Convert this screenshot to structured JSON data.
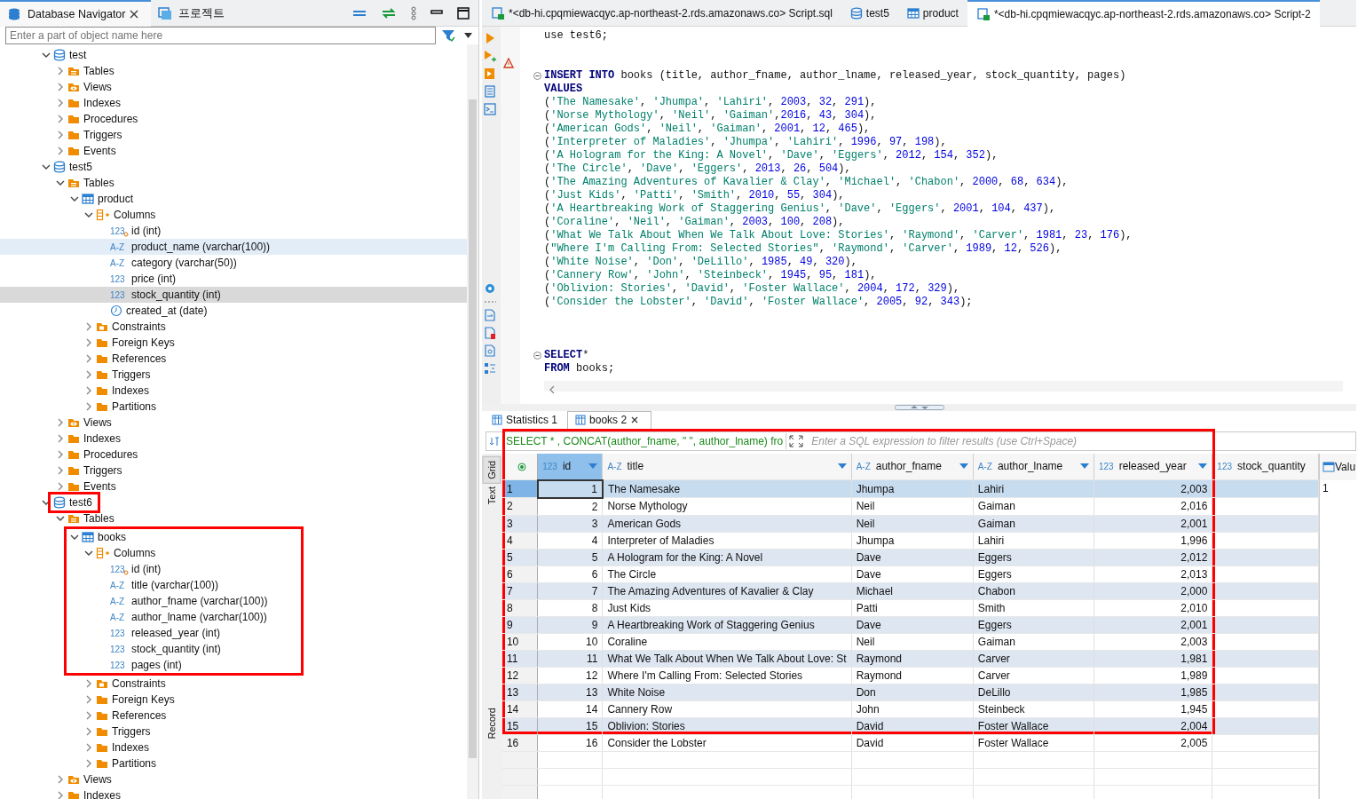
{
  "navigator": {
    "tabs": [
      {
        "label": "Database Navigator",
        "selected": true,
        "closable": true
      },
      {
        "label": "프로젝트",
        "selected": false,
        "closable": false
      }
    ],
    "search": {
      "placeholder": "Enter a part of object name here"
    },
    "tree": [
      {
        "label": "test",
        "kind": "database",
        "expanded": true,
        "selected": false,
        "children": [
          {
            "label": "Tables",
            "kind": "tables",
            "expanded": false,
            "selected": false
          },
          {
            "label": "Views",
            "kind": "views",
            "expanded": false,
            "selected": false
          },
          {
            "label": "Indexes",
            "kind": "folder",
            "expanded": false,
            "selected": false
          },
          {
            "label": "Procedures",
            "kind": "folder",
            "expanded": false,
            "selected": false
          },
          {
            "label": "Triggers",
            "kind": "folder",
            "expanded": false,
            "selected": false
          },
          {
            "label": "Events",
            "kind": "folder",
            "expanded": false,
            "selected": false
          }
        ]
      },
      {
        "label": "test5",
        "kind": "database",
        "expanded": true,
        "selected": false,
        "children": [
          {
            "label": "Tables",
            "kind": "tables",
            "expanded": true,
            "selected": false,
            "children": [
              {
                "label": "product",
                "kind": "table",
                "expanded": true,
                "selected": false,
                "children": [
                  {
                    "label": "Columns",
                    "kind": "columns",
                    "expanded": true,
                    "selected": false,
                    "children": [
                      {
                        "label": "id (int)",
                        "kind": "column",
                        "type": "123",
                        "key": true,
                        "selected": false
                      },
                      {
                        "label": "product_name (varchar(100))",
                        "kind": "column",
                        "type": "A-Z",
                        "hovered": true,
                        "selected": false
                      },
                      {
                        "label": "category (varchar(50))",
                        "kind": "column",
                        "type": "A-Z",
                        "selected": false
                      },
                      {
                        "label": "price (int)",
                        "kind": "column",
                        "type": "123",
                        "selected": false
                      },
                      {
                        "label": "stock_quantity (int)",
                        "kind": "column",
                        "type": "123",
                        "selected": true
                      },
                      {
                        "label": "created_at (date)",
                        "kind": "date_column",
                        "selected": false
                      }
                    ]
                  },
                  {
                    "label": "Constraints",
                    "kind": "constraints",
                    "expanded": false,
                    "selected": false
                  },
                  {
                    "label": "Foreign Keys",
                    "kind": "folder",
                    "expanded": false,
                    "selected": false
                  },
                  {
                    "label": "References",
                    "kind": "folder",
                    "expanded": false,
                    "selected": false
                  },
                  {
                    "label": "Triggers",
                    "kind": "folder",
                    "expanded": false,
                    "selected": false
                  },
                  {
                    "label": "Indexes",
                    "kind": "folder",
                    "expanded": false,
                    "selected": false
                  },
                  {
                    "label": "Partitions",
                    "kind": "folder",
                    "expanded": false,
                    "selected": false
                  }
                ]
              }
            ]
          },
          {
            "label": "Views",
            "kind": "views",
            "expanded": false,
            "selected": false
          },
          {
            "label": "Indexes",
            "kind": "folder",
            "expanded": false,
            "selected": false
          },
          {
            "label": "Procedures",
            "kind": "folder",
            "expanded": false,
            "selected": false
          },
          {
            "label": "Triggers",
            "kind": "folder",
            "expanded": false,
            "selected": false
          },
          {
            "label": "Events",
            "kind": "folder",
            "expanded": false,
            "selected": false
          }
        ]
      },
      {
        "label": "test6",
        "kind": "database",
        "expanded": true,
        "selected": false,
        "highlighted": true,
        "children": [
          {
            "label": "Tables",
            "kind": "tables",
            "expanded": true,
            "selected": false,
            "children": [
              {
                "label": "books",
                "kind": "table",
                "expanded": true,
                "selected": false,
                "highlighted": true,
                "children": [
                  {
                    "label": "Columns",
                    "kind": "columns",
                    "expanded": true,
                    "selected": false,
                    "children": [
                      {
                        "label": "id (int)",
                        "kind": "column",
                        "type": "123",
                        "key": true,
                        "selected": false
                      },
                      {
                        "label": "title (varchar(100))",
                        "kind": "column",
                        "type": "A-Z",
                        "selected": false
                      },
                      {
                        "label": "author_fname (varchar(100))",
                        "kind": "column",
                        "type": "A-Z",
                        "selected": false
                      },
                      {
                        "label": "author_lname (varchar(100))",
                        "kind": "column",
                        "type": "A-Z",
                        "selected": false
                      },
                      {
                        "label": "released_year (int)",
                        "kind": "column",
                        "type": "123",
                        "selected": false
                      },
                      {
                        "label": "stock_quantity (int)",
                        "kind": "column",
                        "type": "123",
                        "selected": false
                      },
                      {
                        "label": "pages (int)",
                        "kind": "column",
                        "type": "123",
                        "selected": false
                      }
                    ]
                  },
                  {
                    "label": "Constraints",
                    "kind": "constraints",
                    "expanded": false,
                    "selected": false
                  },
                  {
                    "label": "Foreign Keys",
                    "kind": "folder",
                    "expanded": false,
                    "selected": false
                  },
                  {
                    "label": "References",
                    "kind": "folder",
                    "expanded": false,
                    "selected": false
                  },
                  {
                    "label": "Triggers",
                    "kind": "folder",
                    "expanded": false,
                    "selected": false
                  },
                  {
                    "label": "Indexes",
                    "kind": "folder",
                    "expanded": false,
                    "selected": false
                  },
                  {
                    "label": "Partitions",
                    "kind": "folder",
                    "expanded": false,
                    "selected": false
                  }
                ]
              }
            ]
          },
          {
            "label": "Views",
            "kind": "views",
            "expanded": false,
            "selected": false
          },
          {
            "label": "Indexes",
            "kind": "folder",
            "expanded": false,
            "selected": false
          }
        ]
      }
    ]
  },
  "editor": {
    "tabs": [
      {
        "label": "*<db-hi.cpqmiewacqyc.ap-northeast-2.rds.amazonaws.co> Script.sql",
        "kind": "script",
        "selected": false
      },
      {
        "label": "test5",
        "kind": "database",
        "selected": false
      },
      {
        "label": "product",
        "kind": "table",
        "selected": false
      },
      {
        "label": "*<db-hi.cpqmiewacqyc.ap-northeast-2.rds.amazonaws.co> Script-2",
        "kind": "script",
        "selected": true
      }
    ],
    "lines": [
      {
        "kind": "code",
        "text": "use test6;"
      },
      {
        "kind": "blank"
      },
      {
        "kind": "blank",
        "warning": true
      },
      {
        "kind": "code",
        "text": "INSERT INTO books (title, author_fname, author_lname, released_year, stock_quantity, pages)",
        "fold": true
      },
      {
        "kind": "code",
        "text": "VALUES"
      },
      {
        "kind": "code",
        "text": "('The Namesake', 'Jhumpa', 'Lahiri', 2003, 32, 291),"
      },
      {
        "kind": "code",
        "text": "('Norse Mythology', 'Neil', 'Gaiman',2016, 43, 304),"
      },
      {
        "kind": "code",
        "text": "('American Gods', 'Neil', 'Gaiman', 2001, 12, 465),"
      },
      {
        "kind": "code",
        "text": "('Interpreter of Maladies', 'Jhumpa', 'Lahiri', 1996, 97, 198),"
      },
      {
        "kind": "code",
        "text": "('A Hologram for the King: A Novel', 'Dave', 'Eggers', 2012, 154, 352),"
      },
      {
        "kind": "code",
        "text": "('The Circle', 'Dave', 'Eggers', 2013, 26, 504),"
      },
      {
        "kind": "code",
        "text": "('The Amazing Adventures of Kavalier & Clay', 'Michael', 'Chabon', 2000, 68, 634),"
      },
      {
        "kind": "code",
        "text": "('Just Kids', 'Patti', 'Smith', 2010, 55, 304),"
      },
      {
        "kind": "code",
        "text": "('A Heartbreaking Work of Staggering Genius', 'Dave', 'Eggers', 2001, 104, 437),"
      },
      {
        "kind": "code",
        "text": "('Coraline', 'Neil', 'Gaiman', 2003, 100, 208),"
      },
      {
        "kind": "code",
        "text": "('What We Talk About When We Talk About Love: Stories', 'Raymond', 'Carver', 1981, 23, 176),"
      },
      {
        "kind": "code",
        "text": "(\"Where I'm Calling From: Selected Stories\", 'Raymond', 'Carver', 1989, 12, 526),"
      },
      {
        "kind": "code",
        "text": "('White Noise', 'Don', 'DeLillo', 1985, 49, 320),"
      },
      {
        "kind": "code",
        "text": "('Cannery Row', 'John', 'Steinbeck', 1945, 95, 181),"
      },
      {
        "kind": "code",
        "text": "('Oblivion: Stories', 'David', 'Foster Wallace', 2004, 172, 329),"
      },
      {
        "kind": "code",
        "text": "('Consider the Lobster', 'David', 'Foster Wallace', 2005, 92, 343);"
      },
      {
        "kind": "blank"
      },
      {
        "kind": "blank"
      },
      {
        "kind": "blank"
      },
      {
        "kind": "code",
        "text": "SELECT*",
        "fold": true
      },
      {
        "kind": "code",
        "text": "FROM books;"
      }
    ]
  },
  "results": {
    "tabs": [
      {
        "label": "Statistics 1",
        "selected": false,
        "closable": false
      },
      {
        "label": "books 2",
        "selected": true,
        "closable": true
      }
    ],
    "query": "SELECT * , CONCAT(author_fname, \" \", author_lname) fro",
    "filter": {
      "placeholder": "Enter a SQL expression to filter results (use Ctrl+Space)"
    },
    "side_tabs": [
      {
        "label": "Grid",
        "selected": true
      },
      {
        "label": "Text",
        "selected": false
      },
      {
        "label": "Record",
        "selected": false
      }
    ],
    "columns": [
      {
        "name": "id",
        "type": "123",
        "selected": true,
        "menu": true
      },
      {
        "name": "title",
        "type": "A-Z",
        "selected": false,
        "menu": true
      },
      {
        "name": "author_fname",
        "type": "A-Z",
        "selected": false,
        "menu": true
      },
      {
        "name": "author_lname",
        "type": "A-Z",
        "selected": false,
        "menu": true
      },
      {
        "name": "released_year",
        "type": "123",
        "selected": false,
        "menu": true
      },
      {
        "name": "stock_quantity",
        "type": "123",
        "selected": false,
        "menu": false
      }
    ],
    "rows": [
      {
        "num": "1",
        "cells": [
          "1",
          "The Namesake",
          "Jhumpa",
          "Lahiri",
          "2,003"
        ],
        "selected": true,
        "highlighted": true
      },
      {
        "num": "2",
        "cells": [
          "2",
          "Norse Mythology",
          "Neil",
          "Gaiman",
          "2,016"
        ],
        "selected": false,
        "highlighted": true
      },
      {
        "num": "3",
        "cells": [
          "3",
          "American Gods",
          "Neil",
          "Gaiman",
          "2,001"
        ],
        "selected": false,
        "highlighted": true
      },
      {
        "num": "4",
        "cells": [
          "4",
          "Interpreter of Maladies",
          "Jhumpa",
          "Lahiri",
          "1,996"
        ],
        "selected": false,
        "highlighted": true
      },
      {
        "num": "5",
        "cells": [
          "5",
          "A Hologram for the King: A Novel",
          "Dave",
          "Eggers",
          "2,012"
        ],
        "selected": false,
        "highlighted": true
      },
      {
        "num": "6",
        "cells": [
          "6",
          "The Circle",
          "Dave",
          "Eggers",
          "2,013"
        ],
        "selected": false,
        "highlighted": true
      },
      {
        "num": "7",
        "cells": [
          "7",
          "The Amazing Adventures of Kavalier & Clay",
          "Michael",
          "Chabon",
          "2,000"
        ],
        "selected": false,
        "highlighted": true
      },
      {
        "num": "8",
        "cells": [
          "8",
          "Just Kids",
          "Patti",
          "Smith",
          "2,010"
        ],
        "selected": false,
        "highlighted": true
      },
      {
        "num": "9",
        "cells": [
          "9",
          "A Heartbreaking Work of Staggering Genius",
          "Dave",
          "Eggers",
          "2,001"
        ],
        "selected": false,
        "highlighted": true
      },
      {
        "num": "10",
        "cells": [
          "10",
          "Coraline",
          "Neil",
          "Gaiman",
          "2,003"
        ],
        "selected": false,
        "highlighted": true
      },
      {
        "num": "11",
        "cells": [
          "11",
          "What We Talk About When We Talk About Love: St",
          "Raymond",
          "Carver",
          "1,981"
        ],
        "selected": false,
        "highlighted": true
      },
      {
        "num": "12",
        "cells": [
          "12",
          "Where I'm Calling From: Selected Stories",
          "Raymond",
          "Carver",
          "1,989"
        ],
        "selected": false,
        "highlighted": true
      },
      {
        "num": "13",
        "cells": [
          "13",
          "White Noise",
          "Don",
          "DeLillo",
          "1,985"
        ],
        "selected": false,
        "highlighted": true
      },
      {
        "num": "14",
        "cells": [
          "14",
          "Cannery Row",
          "John",
          "Steinbeck",
          "1,945"
        ],
        "selected": false,
        "highlighted": true
      },
      {
        "num": "15",
        "cells": [
          "15",
          "Oblivion: Stories",
          "David",
          "Foster Wallace",
          "2,004"
        ],
        "selected": false,
        "highlighted": true
      },
      {
        "num": "16",
        "cells": [
          "16",
          "Consider the Lobster",
          "David",
          "Foster Wallace",
          "2,005"
        ],
        "selected": false,
        "highlighted": false
      }
    ],
    "value_panel": {
      "title": "Valu",
      "value": "1"
    }
  }
}
